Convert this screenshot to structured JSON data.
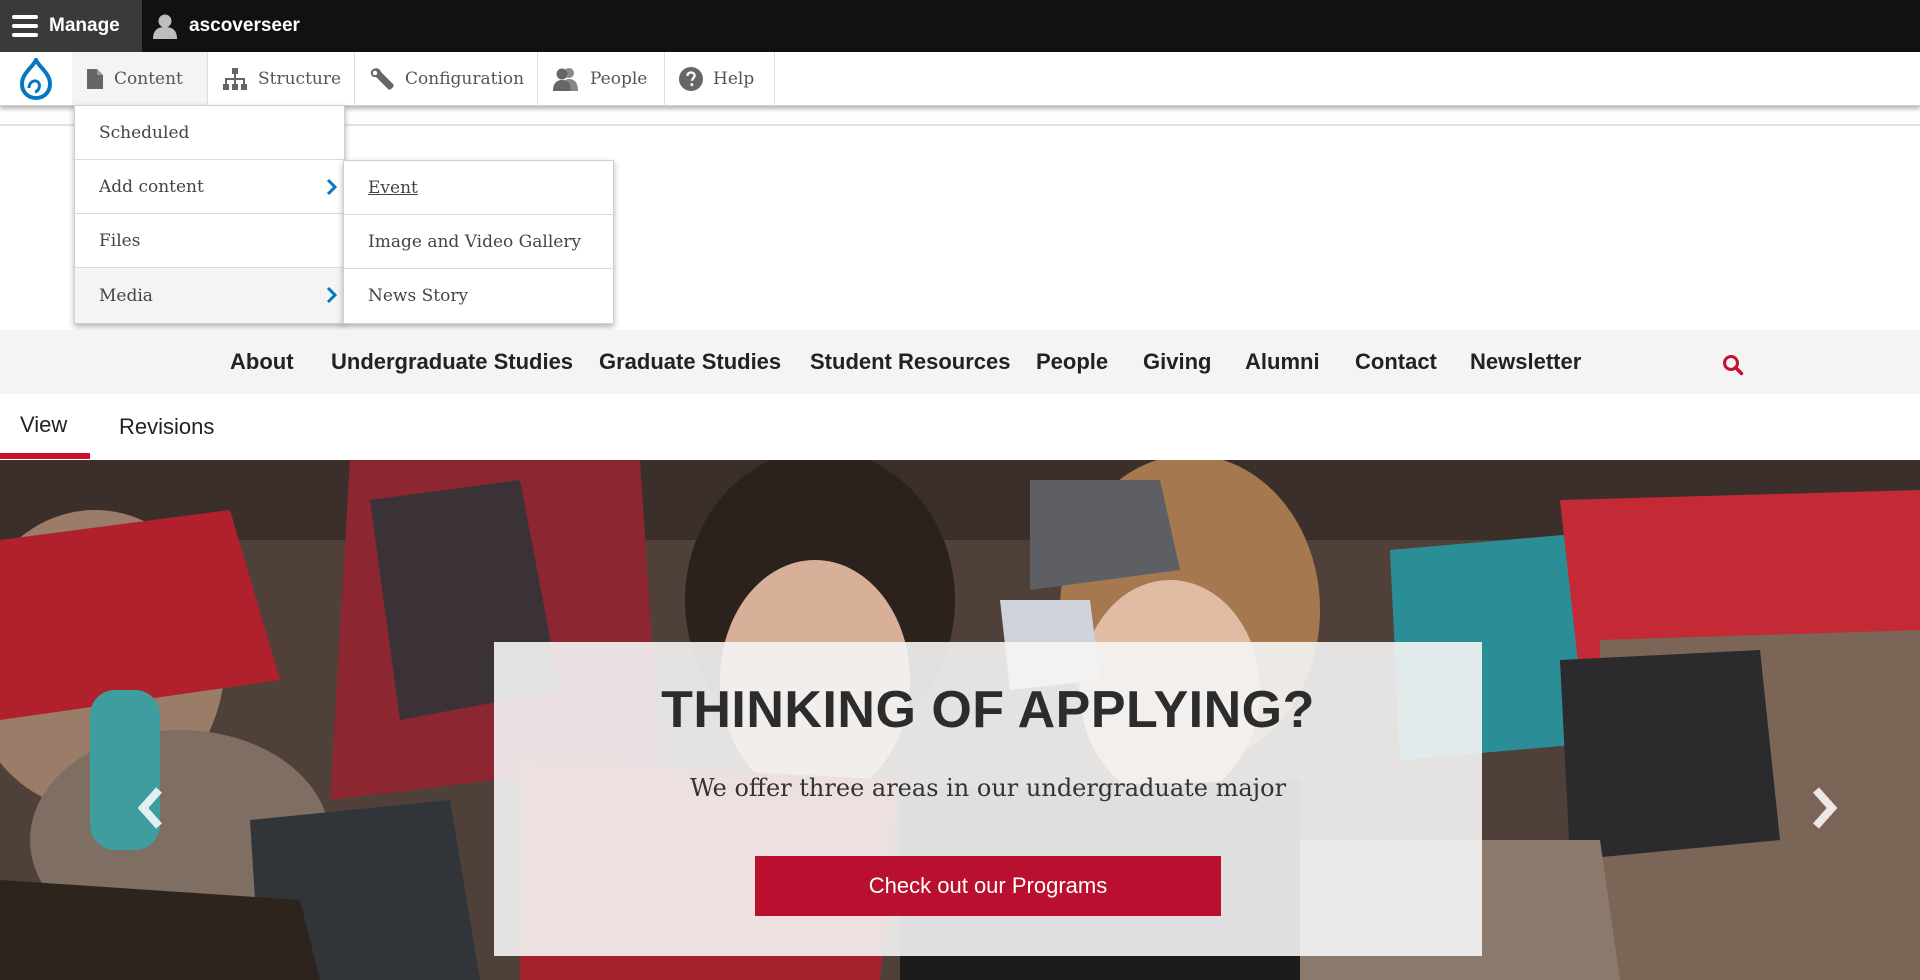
{
  "admin_toolbar": {
    "manage_label": "Manage",
    "user_label": "ascoverseer"
  },
  "tray": {
    "items": [
      {
        "label": "Content",
        "icon": "file-icon"
      },
      {
        "label": "Structure",
        "icon": "sitemap-icon"
      },
      {
        "label": "Configuration",
        "icon": "wrench-icon"
      },
      {
        "label": "People",
        "icon": "people-icon"
      },
      {
        "label": "Help",
        "icon": "help-icon"
      }
    ]
  },
  "content_menu": {
    "items": [
      "Scheduled",
      "Add content",
      "Files",
      "Media"
    ]
  },
  "add_content_menu": {
    "items": [
      "Event",
      "Image and Video Gallery",
      "News Story"
    ]
  },
  "site_nav": {
    "items": [
      "About",
      "Undergraduate Studies",
      "Graduate Studies",
      "Student Resources",
      "People",
      "Giving",
      "Alumni",
      "Contact",
      "Newsletter"
    ]
  },
  "tabs": {
    "view": "View",
    "revisions": "Revisions"
  },
  "hero": {
    "title": "THINKING OF APPLYING?",
    "subtitle": "We offer three areas in our undergraduate major",
    "button_label": "Check out our Programs"
  },
  "colors": {
    "accent": "#c8102e",
    "drupal_blue": "#0678be",
    "admin_bar": "#111111"
  }
}
